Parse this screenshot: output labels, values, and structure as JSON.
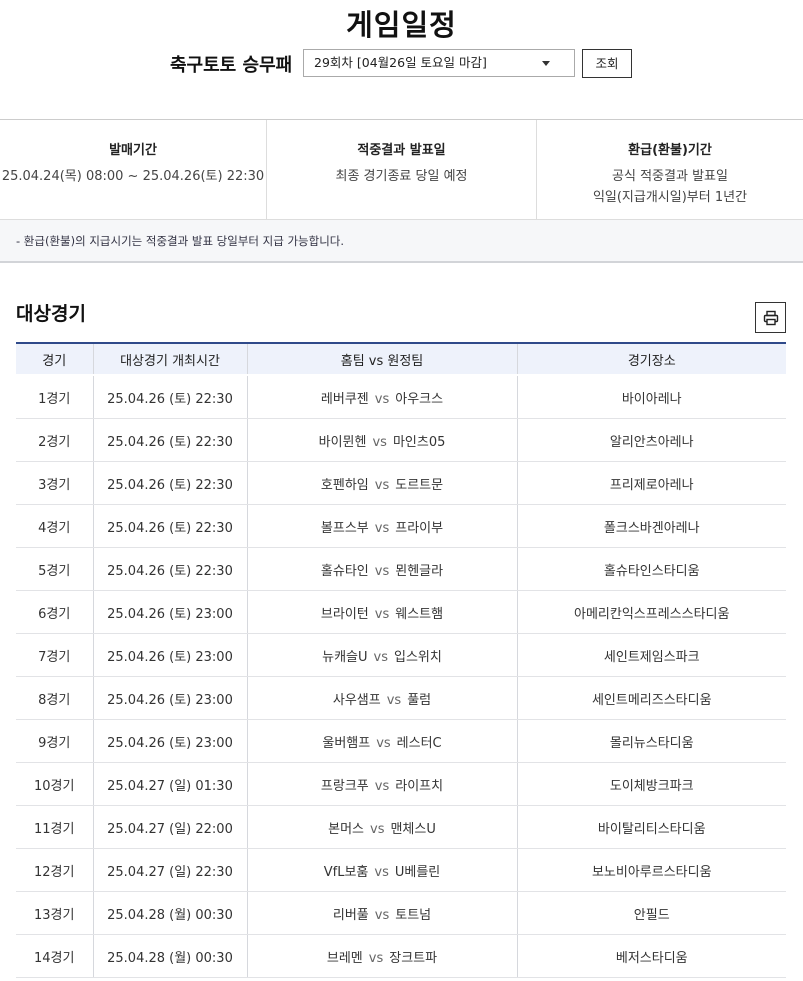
{
  "header": {
    "title": "게임일정",
    "game_label": "축구토토 승무패",
    "round_select": "29회차 [04월26일 토요일 마감]",
    "search_label": "조회"
  },
  "info": {
    "sale": {
      "title": "발매기간",
      "text": "25.04.24(목) 08:00 ~ 25.04.26(토) 22:30"
    },
    "result": {
      "title": "적중결과 발표일",
      "text": "최종 경기종료 당일 예정"
    },
    "refund": {
      "title": "환급(환불)기간",
      "line1": "공식 적중결과 발표일",
      "line2": "익일(지급개시일)부터 1년간"
    }
  },
  "notice": "- 환급(환불)의 지급시기는 적중결과 발표 당일부터 지급 가능합니다.",
  "section": {
    "title": "대상경기",
    "print_icon": "printer-icon"
  },
  "table": {
    "headers": [
      "경기",
      "대상경기 개최시간",
      "홈팀 vs 원정팀",
      "경기장소"
    ],
    "vs": "vs",
    "rows": [
      {
        "no": "1경기",
        "time": "25.04.26 (토) 22:30",
        "home": "레버쿠젠",
        "away": "아우크스",
        "venue": "바이아레나"
      },
      {
        "no": "2경기",
        "time": "25.04.26 (토) 22:30",
        "home": "바이뮌헨",
        "away": "마인츠05",
        "venue": "알리안츠아레나"
      },
      {
        "no": "3경기",
        "time": "25.04.26 (토) 22:30",
        "home": "호펜하임",
        "away": "도르트문",
        "venue": "프리제로아레나"
      },
      {
        "no": "4경기",
        "time": "25.04.26 (토) 22:30",
        "home": "볼프스부",
        "away": "프라이부",
        "venue": "폴크스바겐아레나"
      },
      {
        "no": "5경기",
        "time": "25.04.26 (토) 22:30",
        "home": "홀슈타인",
        "away": "묀헨글라",
        "venue": "홀슈타인스타디움"
      },
      {
        "no": "6경기",
        "time": "25.04.26 (토) 23:00",
        "home": "브라이턴",
        "away": "웨스트햄",
        "venue": "아메리칸익스프레스스타디움"
      },
      {
        "no": "7경기",
        "time": "25.04.26 (토) 23:00",
        "home": "뉴캐슬U",
        "away": "입스위치",
        "venue": "세인트제임스파크"
      },
      {
        "no": "8경기",
        "time": "25.04.26 (토) 23:00",
        "home": "사우샘프",
        "away": "풀럼",
        "venue": "세인트메리즈스타디움"
      },
      {
        "no": "9경기",
        "time": "25.04.26 (토) 23:00",
        "home": "울버햄프",
        "away": "레스터C",
        "venue": "몰리뉴스타디움"
      },
      {
        "no": "10경기",
        "time": "25.04.27 (일) 01:30",
        "home": "프랑크푸",
        "away": "라이프치",
        "venue": "도이체방크파크"
      },
      {
        "no": "11경기",
        "time": "25.04.27 (일) 22:00",
        "home": "본머스",
        "away": "맨체스U",
        "venue": "바이탈리티스타디움"
      },
      {
        "no": "12경기",
        "time": "25.04.27 (일) 22:30",
        "home": "VfL보훔",
        "away": "U베를린",
        "venue": "보노비아루르스타디움"
      },
      {
        "no": "13경기",
        "time": "25.04.28 (월) 00:30",
        "home": "리버풀",
        "away": "토트넘",
        "venue": "안필드"
      },
      {
        "no": "14경기",
        "time": "25.04.28 (월) 00:30",
        "home": "브레멘",
        "away": "장크트파",
        "venue": "베저스타디움"
      }
    ]
  }
}
